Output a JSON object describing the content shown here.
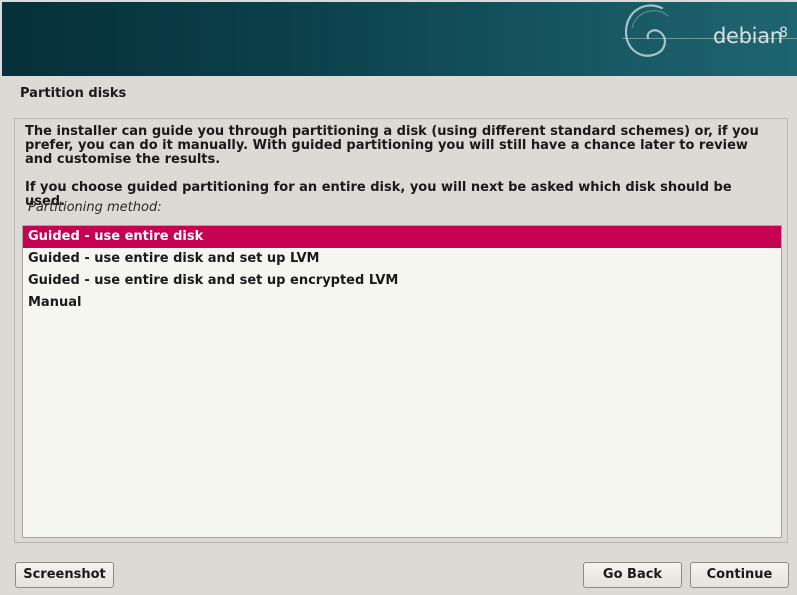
{
  "banner": {
    "brand": "debian",
    "version": "8",
    "logo_icon": "debian-swirl-icon"
  },
  "page": {
    "title": "Partition disks"
  },
  "content": {
    "description": "The installer can guide you through partitioning a disk (using different standard schemes) or, if you prefer, you can do it manually. With guided partitioning you will still have a chance later to review and customise the results.",
    "description2": "If you choose guided partitioning for an entire disk, you will next be asked which disk should be used.",
    "method_label": "Partitioning method:",
    "options": [
      {
        "label": "Guided - use entire disk",
        "selected": true
      },
      {
        "label": "Guided - use entire disk and set up LVM",
        "selected": false
      },
      {
        "label": "Guided - use entire disk and set up encrypted LVM",
        "selected": false
      },
      {
        "label": "Manual",
        "selected": false
      }
    ]
  },
  "buttons": {
    "screenshot": "Screenshot",
    "go_back": "Go Back",
    "continue": "Continue"
  },
  "colors": {
    "selection": "#c70151",
    "banner": "#0b3f4a"
  }
}
